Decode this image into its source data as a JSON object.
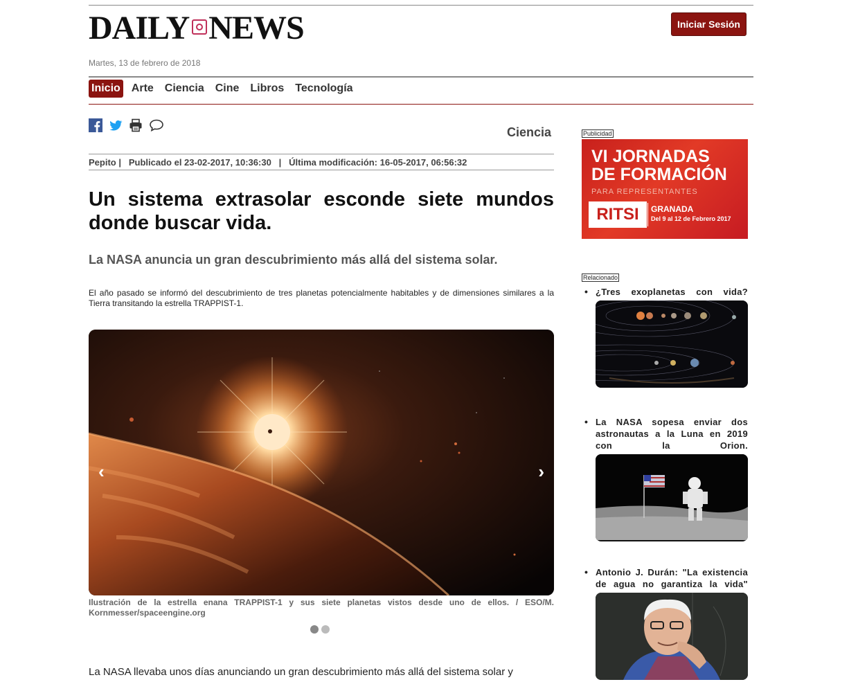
{
  "header": {
    "logo_left": "DAILY",
    "logo_right": "NEWS",
    "login_label": "Iniciar Sesión",
    "date": "Martes, 13 de febrero de 2018"
  },
  "nav": {
    "items": [
      "Inicio",
      "Arte",
      "Ciencia",
      "Cine",
      "Libros",
      "Tecnología"
    ],
    "active": "Inicio"
  },
  "share": {
    "icons": [
      "facebook-icon",
      "twitter-icon",
      "print-icon",
      "comment-icon"
    ]
  },
  "article": {
    "section": "Ciencia",
    "author": "Pepito",
    "published": "Publicado el 23-02-2017, 10:36:30",
    "modified": "Última modificación: 16-05-2017, 06:56:32",
    "title": "Un sistema extrasolar esconde siete mundos donde buscar vida.",
    "subtitle": "La NASA anuncia un gran descubrimiento más allá del sistema solar.",
    "intro": "El año pasado se informó del descubrimiento de tres planetas potencialmente habitables y de dimensiones similares a la Tierra transitando la estrella TRAPPIST-1.",
    "caption": "Ilustración de la estrella enana TRAPPIST-1 y sus siete planetas vistos desde uno de ellos. / ESO/M. Kornmesser/spaceengine.org",
    "body_start": "La NASA llevaba unos días anunciando un gran descubrimiento más allá del sistema solar y"
  },
  "carousel": {
    "prev": "‹",
    "next": "›",
    "slides": 2,
    "current": 1
  },
  "sidebar": {
    "ad_label": "Publicidad",
    "ad": {
      "line1": "VI JORNADAS",
      "line2": "DE FORMACIÓN",
      "line3": "PARA REPRESENTANTES",
      "brand": "RITSI",
      "city": "GRANADA",
      "dates": "Del 9 al 12 de Febrero 2017"
    },
    "related_label": "Relacionado",
    "related": [
      {
        "title": "¿Tres exoplanetas con vida?"
      },
      {
        "title": "La NASA sopesa enviar dos astronautas a la Luna en 2019 con la Orion."
      },
      {
        "title": "Antonio J. Durán: \"La existencia de agua no garantiza la vida\""
      }
    ]
  },
  "colors": {
    "brand": "#8b1410",
    "ad_red": "#c8201c"
  }
}
